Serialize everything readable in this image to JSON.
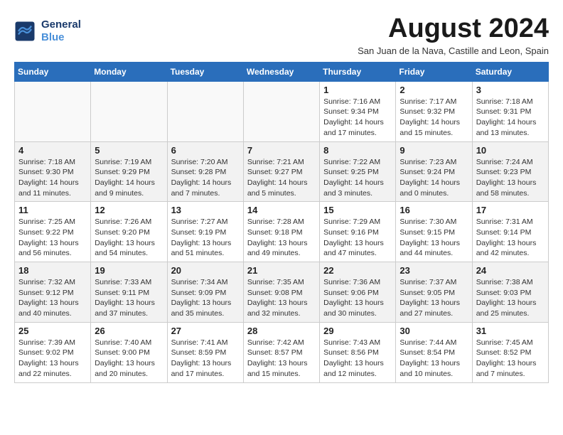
{
  "header": {
    "logo_line1": "General",
    "logo_line2": "Blue",
    "month_year": "August 2024",
    "location": "San Juan de la Nava, Castille and Leon, Spain"
  },
  "weekdays": [
    "Sunday",
    "Monday",
    "Tuesday",
    "Wednesday",
    "Thursday",
    "Friday",
    "Saturday"
  ],
  "weeks": [
    [
      {
        "day": "",
        "info": ""
      },
      {
        "day": "",
        "info": ""
      },
      {
        "day": "",
        "info": ""
      },
      {
        "day": "",
        "info": ""
      },
      {
        "day": "1",
        "info": "Sunrise: 7:16 AM\nSunset: 9:34 PM\nDaylight: 14 hours\nand 17 minutes."
      },
      {
        "day": "2",
        "info": "Sunrise: 7:17 AM\nSunset: 9:32 PM\nDaylight: 14 hours\nand 15 minutes."
      },
      {
        "day": "3",
        "info": "Sunrise: 7:18 AM\nSunset: 9:31 PM\nDaylight: 14 hours\nand 13 minutes."
      }
    ],
    [
      {
        "day": "4",
        "info": "Sunrise: 7:18 AM\nSunset: 9:30 PM\nDaylight: 14 hours\nand 11 minutes."
      },
      {
        "day": "5",
        "info": "Sunrise: 7:19 AM\nSunset: 9:29 PM\nDaylight: 14 hours\nand 9 minutes."
      },
      {
        "day": "6",
        "info": "Sunrise: 7:20 AM\nSunset: 9:28 PM\nDaylight: 14 hours\nand 7 minutes."
      },
      {
        "day": "7",
        "info": "Sunrise: 7:21 AM\nSunset: 9:27 PM\nDaylight: 14 hours\nand 5 minutes."
      },
      {
        "day": "8",
        "info": "Sunrise: 7:22 AM\nSunset: 9:25 PM\nDaylight: 14 hours\nand 3 minutes."
      },
      {
        "day": "9",
        "info": "Sunrise: 7:23 AM\nSunset: 9:24 PM\nDaylight: 14 hours\nand 0 minutes."
      },
      {
        "day": "10",
        "info": "Sunrise: 7:24 AM\nSunset: 9:23 PM\nDaylight: 13 hours\nand 58 minutes."
      }
    ],
    [
      {
        "day": "11",
        "info": "Sunrise: 7:25 AM\nSunset: 9:22 PM\nDaylight: 13 hours\nand 56 minutes."
      },
      {
        "day": "12",
        "info": "Sunrise: 7:26 AM\nSunset: 9:20 PM\nDaylight: 13 hours\nand 54 minutes."
      },
      {
        "day": "13",
        "info": "Sunrise: 7:27 AM\nSunset: 9:19 PM\nDaylight: 13 hours\nand 51 minutes."
      },
      {
        "day": "14",
        "info": "Sunrise: 7:28 AM\nSunset: 9:18 PM\nDaylight: 13 hours\nand 49 minutes."
      },
      {
        "day": "15",
        "info": "Sunrise: 7:29 AM\nSunset: 9:16 PM\nDaylight: 13 hours\nand 47 minutes."
      },
      {
        "day": "16",
        "info": "Sunrise: 7:30 AM\nSunset: 9:15 PM\nDaylight: 13 hours\nand 44 minutes."
      },
      {
        "day": "17",
        "info": "Sunrise: 7:31 AM\nSunset: 9:14 PM\nDaylight: 13 hours\nand 42 minutes."
      }
    ],
    [
      {
        "day": "18",
        "info": "Sunrise: 7:32 AM\nSunset: 9:12 PM\nDaylight: 13 hours\nand 40 minutes."
      },
      {
        "day": "19",
        "info": "Sunrise: 7:33 AM\nSunset: 9:11 PM\nDaylight: 13 hours\nand 37 minutes."
      },
      {
        "day": "20",
        "info": "Sunrise: 7:34 AM\nSunset: 9:09 PM\nDaylight: 13 hours\nand 35 minutes."
      },
      {
        "day": "21",
        "info": "Sunrise: 7:35 AM\nSunset: 9:08 PM\nDaylight: 13 hours\nand 32 minutes."
      },
      {
        "day": "22",
        "info": "Sunrise: 7:36 AM\nSunset: 9:06 PM\nDaylight: 13 hours\nand 30 minutes."
      },
      {
        "day": "23",
        "info": "Sunrise: 7:37 AM\nSunset: 9:05 PM\nDaylight: 13 hours\nand 27 minutes."
      },
      {
        "day": "24",
        "info": "Sunrise: 7:38 AM\nSunset: 9:03 PM\nDaylight: 13 hours\nand 25 minutes."
      }
    ],
    [
      {
        "day": "25",
        "info": "Sunrise: 7:39 AM\nSunset: 9:02 PM\nDaylight: 13 hours\nand 22 minutes."
      },
      {
        "day": "26",
        "info": "Sunrise: 7:40 AM\nSunset: 9:00 PM\nDaylight: 13 hours\nand 20 minutes."
      },
      {
        "day": "27",
        "info": "Sunrise: 7:41 AM\nSunset: 8:59 PM\nDaylight: 13 hours\nand 17 minutes."
      },
      {
        "day": "28",
        "info": "Sunrise: 7:42 AM\nSunset: 8:57 PM\nDaylight: 13 hours\nand 15 minutes."
      },
      {
        "day": "29",
        "info": "Sunrise: 7:43 AM\nSunset: 8:56 PM\nDaylight: 13 hours\nand 12 minutes."
      },
      {
        "day": "30",
        "info": "Sunrise: 7:44 AM\nSunset: 8:54 PM\nDaylight: 13 hours\nand 10 minutes."
      },
      {
        "day": "31",
        "info": "Sunrise: 7:45 AM\nSunset: 8:52 PM\nDaylight: 13 hours\nand 7 minutes."
      }
    ]
  ]
}
